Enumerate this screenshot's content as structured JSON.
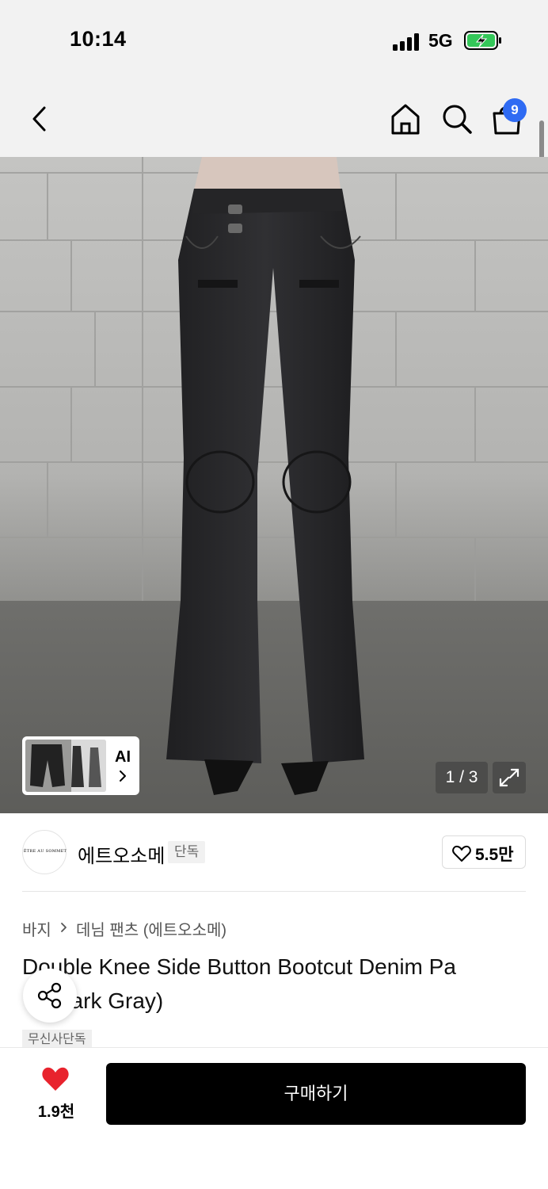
{
  "status_bar": {
    "time": "10:14",
    "network": "5G",
    "icons": [
      "signal-icon",
      "battery-charging-icon"
    ]
  },
  "nav": {
    "icons": [
      "back-icon",
      "home-icon",
      "search-icon",
      "shopping-bag-icon"
    ],
    "cart_badge": "9"
  },
  "gallery": {
    "counter": "1 / 3",
    "ai_label": "AI",
    "icons": [
      "chevron-right-icon",
      "expand-icon"
    ]
  },
  "brand": {
    "logo_text": "ÊTRE AU SOMMET",
    "name": "에트오소메",
    "tag": "단독",
    "like_count": "5.5만"
  },
  "breadcrumb": {
    "level1": "바지",
    "level2": "데님 팬츠 (에트오소메)"
  },
  "product": {
    "title_line1": "Double Knee Side Button Bootcut Denim Pa",
    "title_line2": "(Dark Gray)",
    "exclusive_tag": "무신사단독"
  },
  "bottom": {
    "wish_count": "1.9천",
    "buy_label": "구매하기"
  },
  "colors": {
    "badge_blue": "#2f6bf3",
    "wish_red": "#e8232d",
    "buy_button": "#000000",
    "battery_green": "#34c759"
  }
}
